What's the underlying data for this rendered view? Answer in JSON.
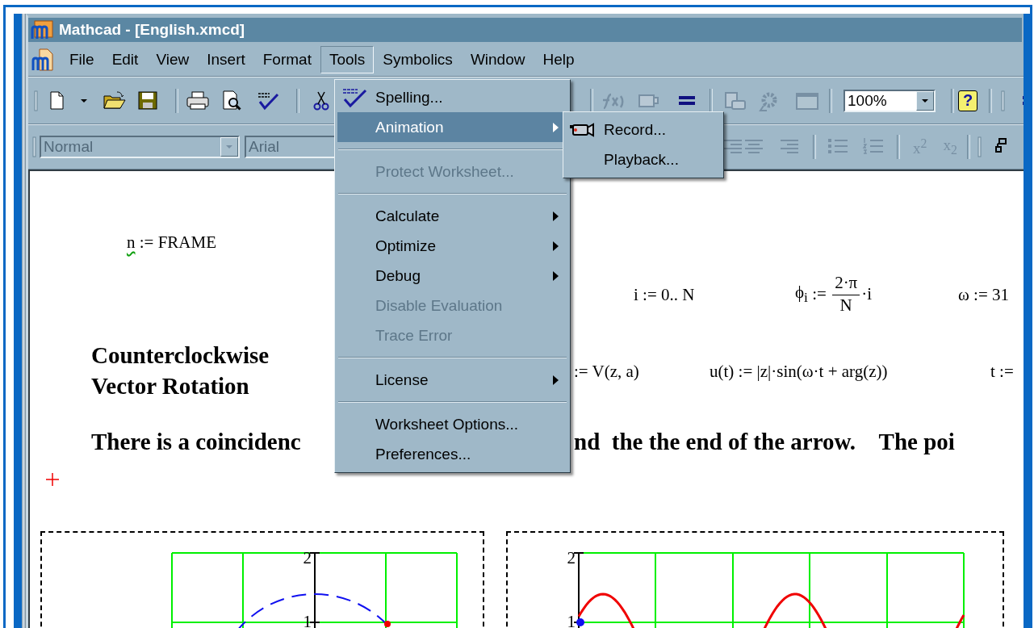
{
  "window": {
    "title": "Mathcad - [English.xmcd]"
  },
  "menu_bar": [
    {
      "label": "File",
      "selected": false
    },
    {
      "label": "Edit",
      "selected": false
    },
    {
      "label": "View",
      "selected": false
    },
    {
      "label": "Insert",
      "selected": false
    },
    {
      "label": "Format",
      "selected": false
    },
    {
      "label": "Tools",
      "selected": true
    },
    {
      "label": "Symbolics",
      "selected": false
    },
    {
      "label": "Window",
      "selected": false
    },
    {
      "label": "Help",
      "selected": false
    }
  ],
  "standard_toolbar": {
    "zoom": {
      "value": "100%"
    },
    "help_button": "?"
  },
  "formatting_toolbar": {
    "style": {
      "value": "Normal",
      "disabled": true
    },
    "font": {
      "value": "Arial",
      "disabled": true
    },
    "buttons": [
      {
        "label": "x$^{2}$"
      },
      {
        "label": "x$_{2}$"
      }
    ]
  },
  "tools_menu": {
    "items": [
      {
        "kind": "item",
        "label": "Spelling...",
        "has_icon": true,
        "disabled": false,
        "selected": false,
        "submenu": false
      },
      {
        "kind": "item",
        "label": "Animation",
        "has_icon": false,
        "disabled": false,
        "selected": true,
        "submenu": true
      },
      {
        "kind": "separator"
      },
      {
        "kind": "item",
        "label": "Protect Worksheet...",
        "has_icon": false,
        "disabled": true,
        "selected": false,
        "submenu": false
      },
      {
        "kind": "separator"
      },
      {
        "kind": "item",
        "label": "Calculate",
        "has_icon": false,
        "disabled": false,
        "selected": false,
        "submenu": true
      },
      {
        "kind": "item",
        "label": "Optimize",
        "has_icon": false,
        "disabled": false,
        "selected": false,
        "submenu": true
      },
      {
        "kind": "item",
        "label": "Debug",
        "has_icon": false,
        "disabled": false,
        "selected": false,
        "submenu": true
      },
      {
        "kind": "item",
        "label": "Disable Evaluation",
        "has_icon": false,
        "disabled": true,
        "selected": false,
        "submenu": false
      },
      {
        "kind": "item",
        "label": "Trace Error",
        "has_icon": false,
        "disabled": true,
        "selected": false,
        "submenu": false
      },
      {
        "kind": "separator"
      },
      {
        "kind": "item",
        "label": "License",
        "has_icon": false,
        "disabled": false,
        "selected": false,
        "submenu": true
      },
      {
        "kind": "separator"
      },
      {
        "kind": "item",
        "label": "Worksheet Options...",
        "has_icon": false,
        "disabled": false,
        "selected": false,
        "submenu": false
      },
      {
        "kind": "item",
        "label": "Preferences...",
        "has_icon": false,
        "disabled": false,
        "selected": false,
        "submenu": false
      }
    ]
  },
  "animation_submenu": {
    "items": [
      {
        "kind": "item",
        "label": "Record...",
        "has_icon": true,
        "disabled": false,
        "selected": false,
        "submenu": false
      },
      {
        "kind": "item",
        "label": "Playback...",
        "has_icon": false,
        "disabled": false,
        "selected": false,
        "submenu": false
      }
    ]
  },
  "worksheet": {
    "expressions": [
      {
        "kind": "plain",
        "name": "n",
        "text": " := FRAME",
        "warning": true
      },
      {
        "kind": "plain",
        "name": "i",
        "text": " := 0.. N",
        "warning": false
      },
      {
        "kind": "fraction",
        "name": "ϕ$_{i}$",
        "text": " := ",
        "numerator": "2·π",
        "denominator": "N",
        "suffix": "·i",
        "warning": false
      },
      {
        "kind": "plain",
        "name": "ω",
        "text": " := 31",
        "warning": false
      },
      {
        "kind": "plain",
        "text": ":= V(z, a)",
        "warning": false
      },
      {
        "kind": "plain",
        "name": "u(t)",
        "text": " := |z|·sin(ω·t + arg(z))",
        "warning": false
      },
      {
        "kind": "plain",
        "name": "t",
        "text": " :=",
        "warning": false
      }
    ],
    "heading": "Counterclockwise Vector Rotation",
    "paragraph_parts": [
      "There is a coincidenc",
      "nd  the the end of the arrow.    The poi"
    ],
    "plots": [
      {
        "kind": "polar",
        "y_ticks": [
          "2",
          "1"
        ]
      },
      {
        "kind": "wave",
        "y_ticks": [
          "2",
          "1"
        ]
      }
    ]
  }
}
